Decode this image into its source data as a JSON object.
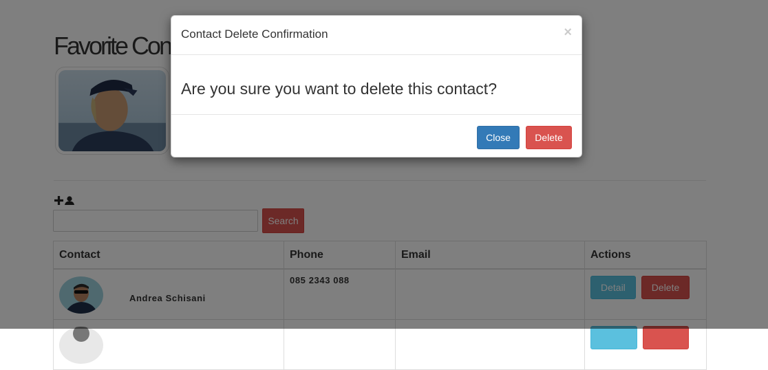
{
  "page": {
    "title": "Favorite Contacts",
    "search": {
      "value": "",
      "placeholder": "",
      "button_label": "Search"
    },
    "table": {
      "headers": [
        "Contact",
        "Phone",
        "Email",
        "Actions"
      ],
      "rows": [
        {
          "name": "Andrea Schisani",
          "phone": "085 2343 088",
          "email": "",
          "detail_label": "Detail",
          "delete_label": "Delete"
        },
        {
          "name": "",
          "phone": "",
          "email": "",
          "detail_label": "",
          "delete_label": ""
        }
      ]
    }
  },
  "modal": {
    "title": "Contact Delete Confirmation",
    "close_glyph": "×",
    "message": "Are you sure you want to delete this contact?",
    "close_label": "Close",
    "delete_label": "Delete"
  },
  "icons": {
    "add": "plus-icon",
    "user": "user-icon",
    "close": "close-icon"
  },
  "colors": {
    "primary": "#337ab7",
    "danger": "#d9534f",
    "info": "#5bc0de",
    "overlay": "rgba(0,0,0,0.5)"
  }
}
